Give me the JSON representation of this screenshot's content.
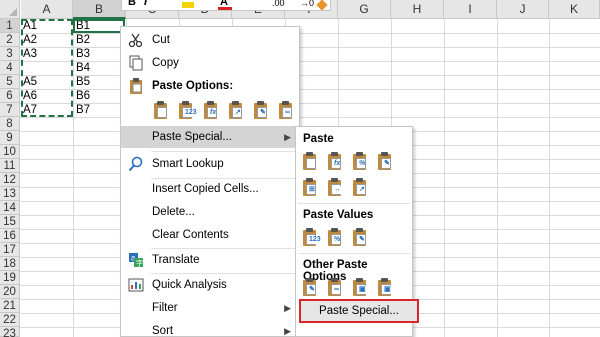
{
  "sheet": {
    "columns": [
      "A",
      "B",
      "C",
      "D",
      "E",
      "F",
      "G",
      "H",
      "I",
      "J",
      "K"
    ],
    "rows": [
      "1",
      "2",
      "3",
      "4",
      "5",
      "6",
      "7",
      "8",
      "9",
      "10",
      "11",
      "12",
      "13",
      "14",
      "15",
      "16",
      "17",
      "18",
      "19",
      "20",
      "21",
      "22",
      "23"
    ],
    "cells": {
      "A1": "A1",
      "A2": "A2",
      "A3": "A3",
      "A5": "A5",
      "A6": "A6",
      "A7": "A7",
      "B1": "B1",
      "B2": "B2",
      "B3": "B3",
      "B4": "B4",
      "B5": "B5",
      "B6": "B6",
      "B7": "B7"
    }
  },
  "mini_toolbar": {
    "items": [
      "B",
      "I",
      "A",
      ".00",
      "→0"
    ]
  },
  "context_menu": {
    "cut": "Cut",
    "copy": "Copy",
    "paste_options": "Paste Options:",
    "paste_special": "Paste Special...",
    "smart_lookup": "Smart Lookup",
    "insert_copied": "Insert Copied Cells...",
    "delete": "Delete...",
    "clear_contents": "Clear Contents",
    "translate": "Translate",
    "quick_analysis": "Quick Analysis",
    "filter": "Filter",
    "sort": "Sort"
  },
  "submenu": {
    "paste": "Paste",
    "paste_values": "Paste Values",
    "other_paste_options": "Other Paste Options",
    "paste_special": "Paste Special..."
  },
  "colors": {
    "accent": "#217346",
    "highlight_border": "#d9262a",
    "clipboard": "#c08a3e"
  }
}
